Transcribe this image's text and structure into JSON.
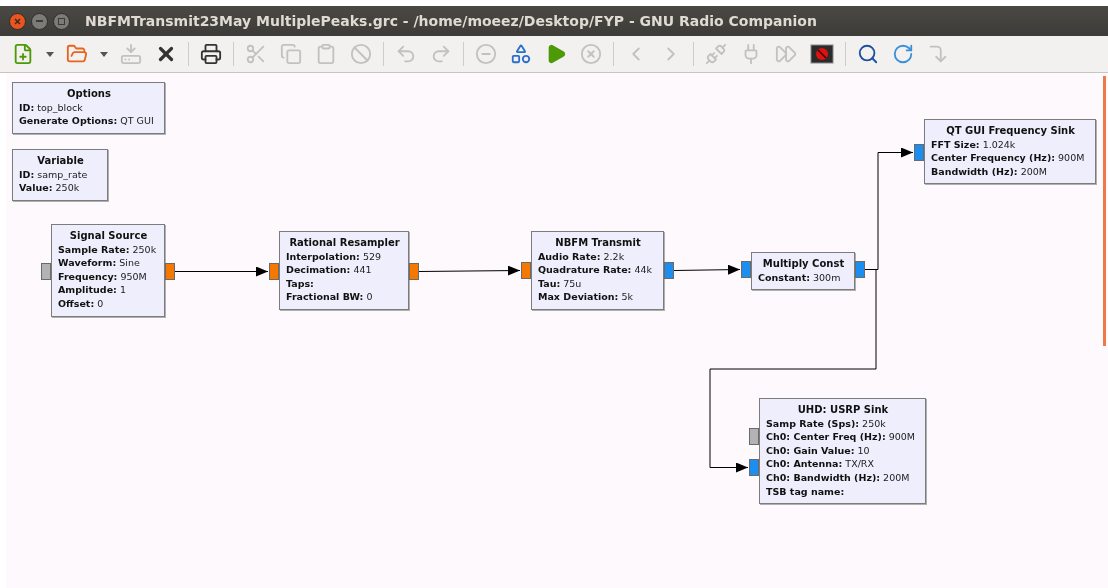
{
  "window": {
    "title": "NBFMTransmit23May MultiplePeaks.grc - /home/moeez/Desktop/FYP - GNU Radio Companion"
  },
  "toolbar": [
    {
      "kind": "new",
      "disabled": false
    },
    {
      "kind": "dropdown",
      "disabled": false
    },
    {
      "kind": "open",
      "disabled": false
    },
    {
      "kind": "dropdown",
      "disabled": false
    },
    {
      "kind": "save",
      "disabled": true
    },
    {
      "kind": "close",
      "disabled": false
    },
    {
      "kind": "separator"
    },
    {
      "kind": "print",
      "disabled": false
    },
    {
      "kind": "separator"
    },
    {
      "kind": "cut",
      "disabled": true
    },
    {
      "kind": "copy",
      "disabled": true
    },
    {
      "kind": "paste",
      "disabled": true
    },
    {
      "kind": "disable",
      "disabled": true
    },
    {
      "kind": "separator"
    },
    {
      "kind": "undo",
      "disabled": true
    },
    {
      "kind": "redo",
      "disabled": true
    },
    {
      "kind": "separator"
    },
    {
      "kind": "remove",
      "disabled": true
    },
    {
      "kind": "types",
      "disabled": false
    },
    {
      "kind": "execute",
      "disabled": false
    },
    {
      "kind": "stop",
      "disabled": true
    },
    {
      "kind": "separator"
    },
    {
      "kind": "rotate-left",
      "disabled": true
    },
    {
      "kind": "rotate-right",
      "disabled": true
    },
    {
      "kind": "separator"
    },
    {
      "kind": "enable",
      "disabled": true
    },
    {
      "kind": "bypass",
      "disabled": true
    },
    {
      "kind": "skip",
      "disabled": true
    },
    {
      "kind": "kill",
      "disabled": false
    },
    {
      "kind": "separator"
    },
    {
      "kind": "find",
      "disabled": false
    },
    {
      "kind": "reload",
      "disabled": false
    },
    {
      "kind": "redo-down",
      "disabled": true
    }
  ],
  "blocks": [
    {
      "title": "Options",
      "params": [
        {
          "label": "ID:",
          "value": "top_block"
        },
        {
          "label": "Generate Options:",
          "value": "QT GUI"
        }
      ]
    },
    {
      "title": "Variable",
      "params": [
        {
          "label": "ID:",
          "value": "samp_rate"
        },
        {
          "label": "Value:",
          "value": "250k"
        }
      ]
    },
    {
      "title": "Signal Source",
      "params": [
        {
          "label": "Sample Rate:",
          "value": "250k"
        },
        {
          "label": "Waveform:",
          "value": "Sine"
        },
        {
          "label": "Frequency:",
          "value": "950M"
        },
        {
          "label": "Amplitude:",
          "value": "1"
        },
        {
          "label": "Offset:",
          "value": "0"
        }
      ],
      "inputs": [
        {
          "color": "#b3b3b3"
        }
      ],
      "outputs": [
        {
          "color": "#f57900"
        }
      ]
    },
    {
      "title": "Rational Resampler",
      "params": [
        {
          "label": "Interpolation:",
          "value": "529"
        },
        {
          "label": "Decimation:",
          "value": "441"
        },
        {
          "label": "Taps:"
        },
        {
          "label": "Fractional BW:",
          "value": "0"
        }
      ],
      "inputs": [
        {
          "color": "#f57900"
        }
      ],
      "outputs": [
        {
          "color": "#f57900"
        }
      ]
    },
    {
      "title": "NBFM Transmit",
      "params": [
        {
          "label": "Audio Rate:",
          "value": "2.2k"
        },
        {
          "label": "Quadrature Rate:",
          "value": "44k"
        },
        {
          "label": "Tau:",
          "value": "75u"
        },
        {
          "label": "Max Deviation:",
          "value": "5k"
        }
      ],
      "inputs": [
        {
          "color": "#f57900"
        }
      ],
      "outputs": [
        {
          "color": "#1c8ef0"
        }
      ]
    },
    {
      "title": "Multiply Const",
      "params": [
        {
          "label": "Constant:",
          "value": "300m"
        }
      ],
      "inputs": [
        {
          "color": "#1c8ef0"
        }
      ],
      "outputs": [
        {
          "color": "#1c8ef0"
        }
      ]
    },
    {
      "title": "QT GUI Frequency Sink",
      "params": [
        {
          "label": "FFT Size:",
          "value": "1.024k"
        },
        {
          "label": "Center Frequency (Hz):",
          "value": "900M"
        },
        {
          "label": "Bandwidth (Hz):",
          "value": "200M"
        }
      ],
      "inputs": [
        {
          "color": "#1c8ef0"
        }
      ]
    },
    {
      "title": "UHD: USRP Sink",
      "params": [
        {
          "label": "Samp Rate (Sps):",
          "value": "250k"
        },
        {
          "label": "Ch0: Center Freq (Hz):",
          "value": "900M"
        },
        {
          "label": "Ch0: Gain Value:",
          "value": "10"
        },
        {
          "label": "Ch0: Antenna:",
          "value": "TX/RX"
        },
        {
          "label": "Ch0: Bandwidth (Hz):",
          "value": "200M"
        },
        {
          "label": "TSB tag name:"
        }
      ],
      "inputs": [
        {
          "color": "#b3b3b3"
        },
        {
          "color": "#1c8ef0"
        }
      ]
    }
  ]
}
